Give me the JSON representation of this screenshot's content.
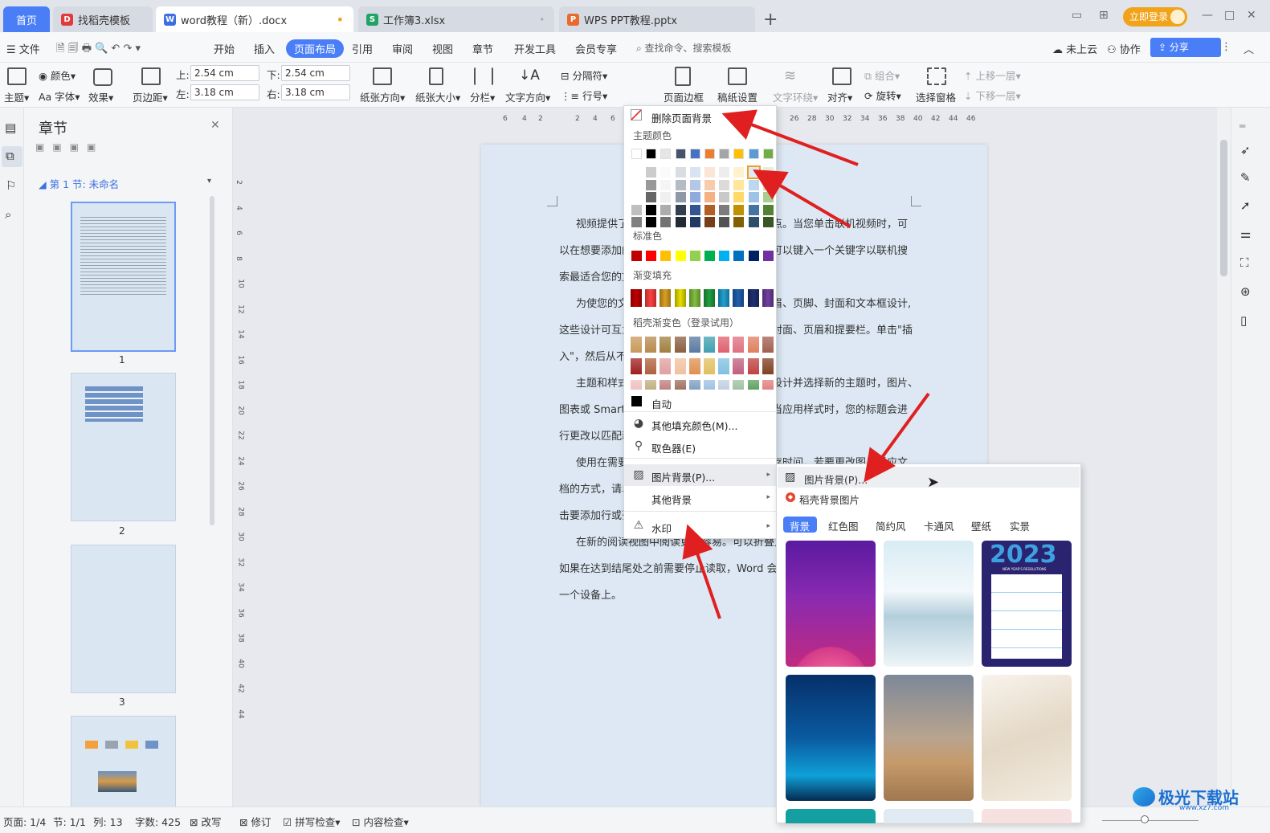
{
  "tabs": {
    "home": "首页",
    "template": "找稻壳模板",
    "doc": "word教程（新）.docx",
    "xlsx": "工作簿3.xlsx",
    "pptx": "WPS PPT教程.pptx",
    "login": "立即登录"
  },
  "menubar": {
    "file": "文件",
    "items": [
      "开始",
      "插入",
      "页面布局",
      "引用",
      "审阅",
      "视图",
      "章节",
      "开发工具",
      "会员专享"
    ],
    "search": "查找命令、搜索模板",
    "cloud": "未上云",
    "collab": "协作",
    "share": "分享"
  },
  "ribbon": {
    "theme": "主题",
    "color": "颜色",
    "font": "Aa 字体",
    "effect": "效果",
    "margin": "页边距",
    "top_label": "上:",
    "top_val": "2.54 cm",
    "bottom_label": "下:",
    "bottom_val": "2.54 cm",
    "left_label": "左:",
    "left_val": "3.18 cm",
    "right_label": "右:",
    "right_val": "3.18 cm",
    "orientation": "纸张方向",
    "size": "纸张大小",
    "columns": "分栏",
    "text_dir": "文字方向",
    "separator": "分隔符",
    "line_num": "行号",
    "background": "背景",
    "page_border": "页面边框",
    "paper_setup": "稿纸设置",
    "wrap": "文字环绕",
    "align": "对齐",
    "group": "组合",
    "rotate": "旋转",
    "select_pane": "选择窗格",
    "bring_fwd": "上移一层",
    "send_back": "下移一层"
  },
  "nav": {
    "title": "章节",
    "section": "第 1 节: 未命名",
    "pages": [
      "1",
      "2",
      "3"
    ]
  },
  "ruler": {
    "top": [
      "6",
      "4",
      "2",
      "2",
      "4",
      "6",
      "26",
      "28",
      "30",
      "32",
      "34",
      "36",
      "38",
      "40",
      "42",
      "44",
      "46"
    ],
    "left": [
      "2",
      "4",
      "6",
      "8",
      "10",
      "12",
      "14",
      "16",
      "18",
      "20",
      "22",
      "24",
      "26",
      "28",
      "30",
      "32",
      "34",
      "36",
      "38",
      "40",
      "42",
      "44"
    ]
  },
  "doc": {
    "lines": [
      "视频提供了",
      "点。当您单击联机视频时，可",
      "以在想要添加的",
      "可以键入一个关键字以联机搜",
      "索最适合您的文",
      "为使您的文",
      "眉、页脚、封面和文本框设计,",
      "这些设计可互为",
      "封面、页眉和提要栏。单击\"插",
      "入\"，然后从不同",
      "主题和样式",
      "设计并选择新的主题时，图片、",
      "图表或 SmartA",
      "当应用样式时，您的标题会进",
      "行更改以匹配新",
      "使用在需要",
      "存时间。若要更改图片适应文",
      "档的方式，请单",
      "击要添加行或列",
      "在新的阅读视图中阅读更加容易。可以折叠文",
      "如果在达到结尾处之前需要停止读取，Word 会记",
      "一个设备上。"
    ]
  },
  "bgmenu": {
    "remove": "删除页面背景",
    "theme_colors": "主题颜色",
    "standard": "标准色",
    "gradient": "渐变填充",
    "daoke_gradient": "稻壳渐变色（登录试用）",
    "auto": "自动",
    "more_colors": "其他填充颜色(M)...",
    "picker": "取色器(E)",
    "picture_bg": "图片背景(P)...",
    "other_bg": "其他背景",
    "watermark": "水印"
  },
  "theme_row": [
    "#ffffff",
    "#000000",
    "#e7e6e6",
    "#44546a",
    "#4472c4",
    "#ed7d31",
    "#a5a5a5",
    "#ffc000",
    "#5b9bd5",
    "#70ad47"
  ],
  "standard_row": [
    "#c00000",
    "#ff0000",
    "#ffc000",
    "#ffff00",
    "#92d050",
    "#00b050",
    "#00b0f0",
    "#0070c0",
    "#002060",
    "#7030a0"
  ],
  "gradient_row": [
    "#c00000",
    "#ff4040",
    "#d8a020",
    "#e8e000",
    "#80c040",
    "#20a040",
    "#20a0d0",
    "#2060b0",
    "#203070",
    "#7040a0"
  ],
  "submenu": {
    "picture_bg": "图片背景(P)...",
    "daoke_pics": "稻壳背景图片",
    "categories": [
      "背景",
      "红色图",
      "简约风",
      "卡通风",
      "壁纸",
      "实景"
    ],
    "thumb_text": "2023",
    "thumb_sub": "NEW YEAR'S RESOLUTIONS"
  },
  "status": {
    "page": "页面: 1/4",
    "section": "节: 1/1",
    "col": "列: 13",
    "words": "字数: 425",
    "rewrite": "改写",
    "revise": "修订",
    "spell": "拼写检查",
    "content": "内容检查"
  },
  "watermark_text": "极光下载站",
  "watermark_url": "www.xz7.com"
}
